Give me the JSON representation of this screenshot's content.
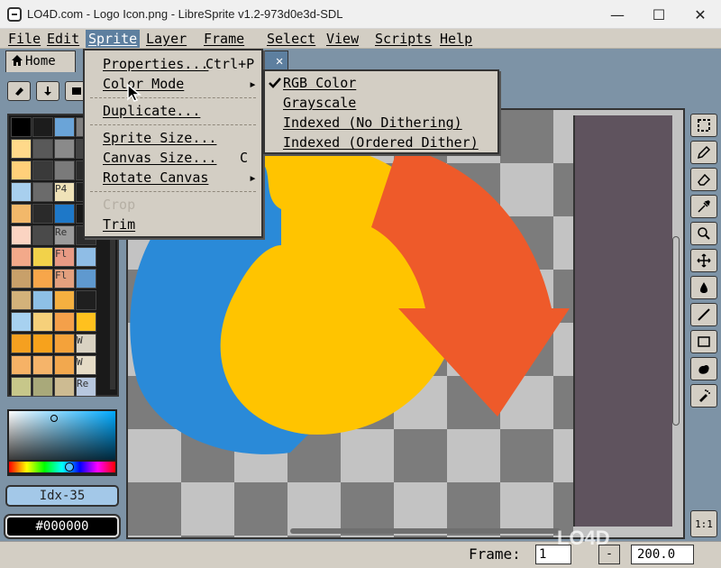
{
  "window": {
    "title": "LO4D.com - Logo Icon.png - LibreSprite v1.2-973d0e3d-SDL",
    "min_symbol": "—",
    "max_symbol": "☐",
    "close_symbol": "✕"
  },
  "menubar": {
    "items": [
      "File",
      "Edit",
      "Sprite",
      "Layer",
      "Frame",
      "Select",
      "View",
      "Scripts",
      "Help"
    ],
    "active": "Sprite"
  },
  "tabs": {
    "home_label": "Home",
    "file_tab_label": "p",
    "close_symbol": "✕"
  },
  "toolbar": {
    "buttons": [
      "erase-icon",
      "down-arrow-icon",
      "square-icon"
    ]
  },
  "palette": {
    "swatch_texts": [
      "P4",
      "Re",
      "Fl",
      "Fl",
      "W",
      "W",
      "Re"
    ]
  },
  "color": {
    "index_label": "Idx-35",
    "hex_label": "#000000"
  },
  "sprite_menu": {
    "items": [
      {
        "label": "Properties...",
        "shortcut": "Ctrl+P"
      },
      {
        "label": "Color Mode",
        "shortcut": "▸"
      },
      {
        "label": "Duplicate..."
      },
      {
        "label": "Sprite Size..."
      },
      {
        "label": "Canvas Size...",
        "shortcut": "C"
      },
      {
        "label": "Rotate Canvas",
        "shortcut": "▸"
      },
      {
        "label": "Crop"
      },
      {
        "label": "Trim"
      }
    ]
  },
  "color_mode_menu": {
    "items": [
      {
        "label": "RGB Color",
        "checked": true
      },
      {
        "label": "Grayscale"
      },
      {
        "label": "Indexed (No Dithering)"
      },
      {
        "label": "Indexed (Ordered Dither)"
      }
    ]
  },
  "tools": {
    "icons": [
      "marquee-icon",
      "pencil-icon",
      "eraser-icon",
      "eyedropper-icon",
      "zoom-icon",
      "move-icon",
      "fill-icon",
      "line-icon",
      "rectangle-icon",
      "blob-icon",
      "spray-icon"
    ],
    "one_to_one": "1:1"
  },
  "statusbar": {
    "frame_label": "Frame:",
    "frame_value": "1",
    "zoom_minus": "-",
    "zoom_value": "200.0"
  },
  "watermark": "LO4D",
  "colors": {
    "accent": "#5d7f9f",
    "chrome": "#d3cec4",
    "desktop": "#7d93a6",
    "logo_yellow": "#ffc400",
    "logo_red": "#ee5a2a",
    "logo_blue": "#2a8ad8"
  }
}
